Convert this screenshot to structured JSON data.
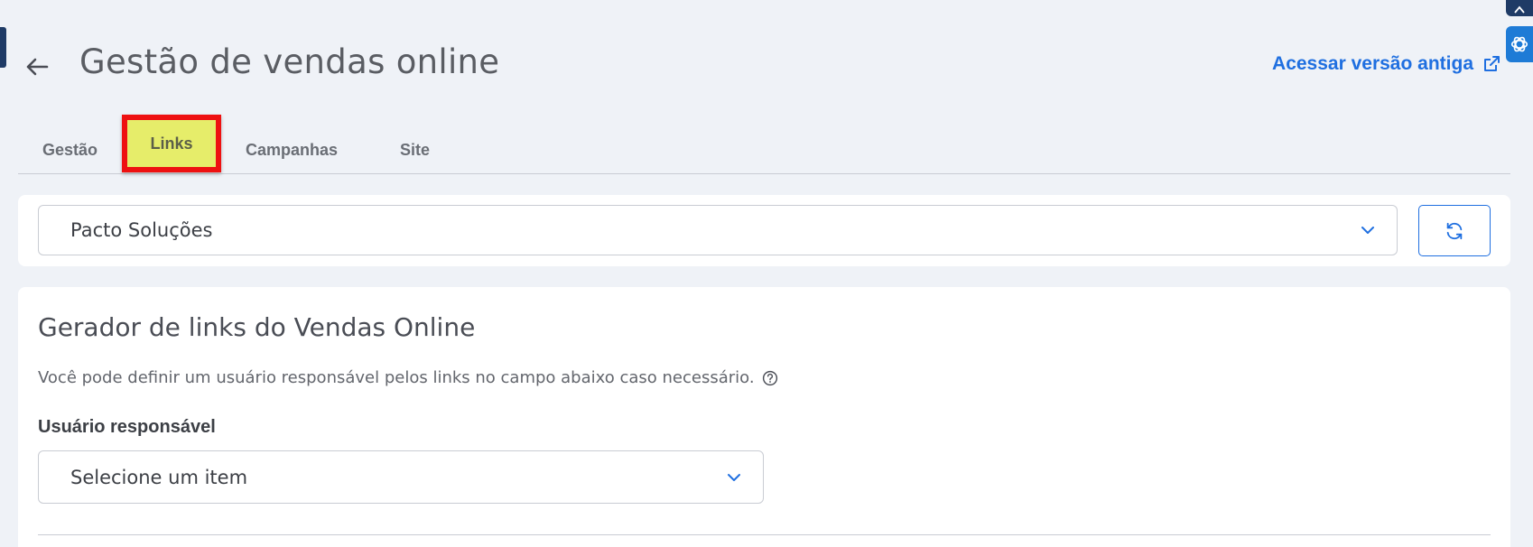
{
  "header": {
    "title": "Gestão de vendas online",
    "old_version_label": "Acessar versão antiga"
  },
  "tabs": [
    {
      "label": "Gestão"
    },
    {
      "label": "Links"
    },
    {
      "label": "Campanhas"
    },
    {
      "label": "Site"
    }
  ],
  "active_tab": "Links",
  "company_select": {
    "value": "Pacto Soluções"
  },
  "link_generator": {
    "title": "Gerador de links do Vendas Online",
    "description": "Você pode definir um usuário responsável pelos links no campo abaixo caso necessário.",
    "user_field_label": "Usuário responsável",
    "user_select_placeholder": "Selecione um item"
  },
  "icons": {
    "back": "arrow-left-icon",
    "external_link": "external-link-icon",
    "chevron": "chevron-down-icon",
    "refresh": "refresh-icon",
    "help": "help-circle-icon",
    "assistant": "chatgpt-icon"
  },
  "colors": {
    "accent": "#1f6fe0",
    "highlight_border": "#ee1111",
    "highlight_fill": "#e6ed6a",
    "background": "#eff2f7"
  }
}
